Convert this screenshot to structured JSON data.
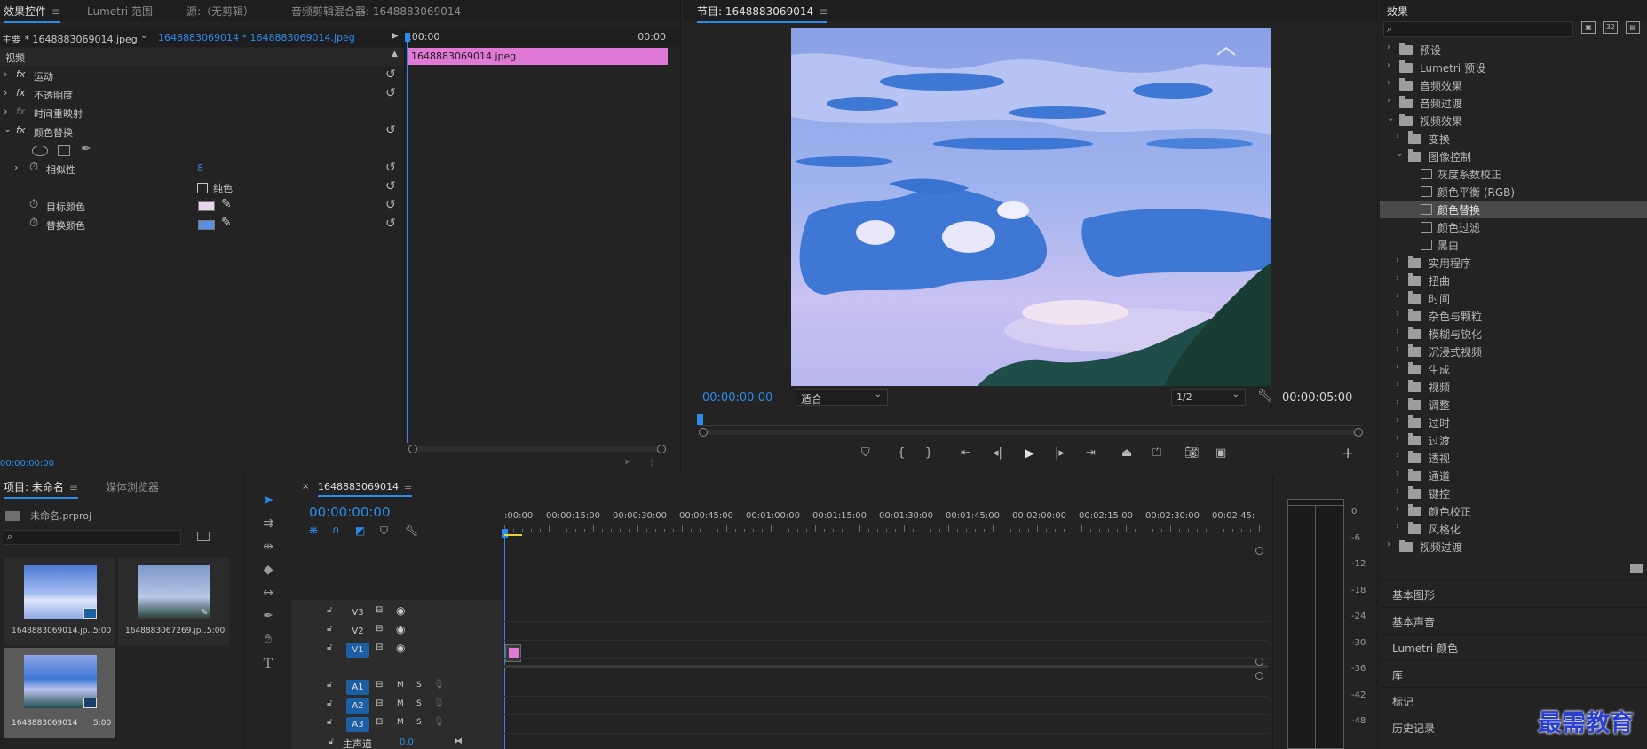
{
  "effect_controls": {
    "tabs": [
      "效果控件",
      "Lumetri 范围",
      "源:（无剪辑）",
      "音频剪辑混合器: 1648883069014"
    ],
    "master_clip": "主要 * 1648883069014.jpeg",
    "sequence_clip": "1648883069014 * 1648883069014.jpeg",
    "time_start": ":00:00",
    "time_end": "00:00",
    "clip_bar_label": "1648883069014.jpeg",
    "section_video": "视频",
    "effects": [
      "运动",
      "不透明度",
      "时间重映射",
      "颜色替换"
    ],
    "fx_label": "fx",
    "similarity_label": "相似性",
    "similarity_value": "8",
    "solid_color_label": "纯色",
    "target_color_label": "目标颜色",
    "replace_color_label": "替换颜色",
    "target_color": "#e8d4ec",
    "replace_color": "#5b8fe0",
    "current_time": "00:00:00:00"
  },
  "program_monitor": {
    "title": "节目: 1648883069014",
    "timecode": "00:00:00:00",
    "fit": "适合",
    "resolution": "1/2",
    "duration": "00:00:05:00",
    "playhead_fraction": 0.0
  },
  "project_panel": {
    "tabs": [
      "项目: 未命名",
      "媒体浏览器"
    ],
    "project_file": "未命名.prproj",
    "search_placeholder": "",
    "items": [
      {
        "name": "1648883069014.jp...",
        "duration": "5:00"
      },
      {
        "name": "1648883067269.jp...",
        "duration": "5:00"
      },
      {
        "name": "1648883069014",
        "duration": "5:00"
      }
    ]
  },
  "timeline": {
    "tab": "1648883069014",
    "timecode": "00:00:00:00",
    "ruler": [
      ":00:00",
      "00:00:15:00",
      "00:00:30:00",
      "00:00:45:00",
      "00:01:00:00",
      "00:01:15:00",
      "00:01:30:00",
      "00:01:45:00",
      "00:02:00:00",
      "00:02:15:00",
      "00:02:30:00",
      "00:02:45:"
    ],
    "video_tracks": [
      "V3",
      "V2",
      "V1"
    ],
    "audio_tracks": [
      "A1",
      "A2",
      "A3"
    ],
    "audio_m": "M",
    "audio_s": "S",
    "master_label": "主声道",
    "master_value": "0.0"
  },
  "audio_meter": {
    "scale": [
      "0",
      "-6",
      "-12",
      "-18",
      "-24",
      "-30",
      "-36",
      "-42",
      "-48"
    ]
  },
  "effects_panel": {
    "title": "效果",
    "tree": [
      {
        "label": "预设",
        "level": 0,
        "type": "folder",
        "open": false
      },
      {
        "label": "Lumetri 预设",
        "level": 0,
        "type": "folder",
        "open": false
      },
      {
        "label": "音频效果",
        "level": 0,
        "type": "folder",
        "open": false
      },
      {
        "label": "音频过渡",
        "level": 0,
        "type": "folder",
        "open": false
      },
      {
        "label": "视频效果",
        "level": 0,
        "type": "folder",
        "open": true
      },
      {
        "label": "变换",
        "level": 1,
        "type": "folder",
        "open": false
      },
      {
        "label": "图像控制",
        "level": 1,
        "type": "folder",
        "open": true
      },
      {
        "label": "灰度系数校正",
        "level": 2,
        "type": "effect"
      },
      {
        "label": "颜色平衡 (RGB)",
        "level": 2,
        "type": "effect"
      },
      {
        "label": "颜色替换",
        "level": 2,
        "type": "effect",
        "selected": true
      },
      {
        "label": "颜色过滤",
        "level": 2,
        "type": "effect"
      },
      {
        "label": "黑白",
        "level": 2,
        "type": "effect"
      },
      {
        "label": "实用程序",
        "level": 1,
        "type": "folder",
        "open": false
      },
      {
        "label": "扭曲",
        "level": 1,
        "type": "folder",
        "open": false
      },
      {
        "label": "时间",
        "level": 1,
        "type": "folder",
        "open": false
      },
      {
        "label": "杂色与颗粒",
        "level": 1,
        "type": "folder",
        "open": false
      },
      {
        "label": "模糊与锐化",
        "level": 1,
        "type": "folder",
        "open": false
      },
      {
        "label": "沉浸式视频",
        "level": 1,
        "type": "folder",
        "open": false
      },
      {
        "label": "生成",
        "level": 1,
        "type": "folder",
        "open": false
      },
      {
        "label": "视频",
        "level": 1,
        "type": "folder",
        "open": false
      },
      {
        "label": "调整",
        "level": 1,
        "type": "folder",
        "open": false
      },
      {
        "label": "过时",
        "level": 1,
        "type": "folder",
        "open": false
      },
      {
        "label": "过渡",
        "level": 1,
        "type": "folder",
        "open": false
      },
      {
        "label": "透视",
        "level": 1,
        "type": "folder",
        "open": false
      },
      {
        "label": "通道",
        "level": 1,
        "type": "folder",
        "open": false
      },
      {
        "label": "键控",
        "level": 1,
        "type": "folder",
        "open": false
      },
      {
        "label": "颜色校正",
        "level": 1,
        "type": "folder",
        "open": false
      },
      {
        "label": "风格化",
        "level": 1,
        "type": "folder",
        "open": false
      },
      {
        "label": "视频过渡",
        "level": 0,
        "type": "folder",
        "open": false
      }
    ],
    "sections": [
      "基本图形",
      "基本声音",
      "Lumetri 颜色",
      "库",
      "标记",
      "历史记录"
    ]
  },
  "watermark": "最需教育",
  "colors": {
    "accent": "#2d8ceb",
    "clip_pink": "#e07ad6",
    "track_blue": "#1c5fa3"
  }
}
